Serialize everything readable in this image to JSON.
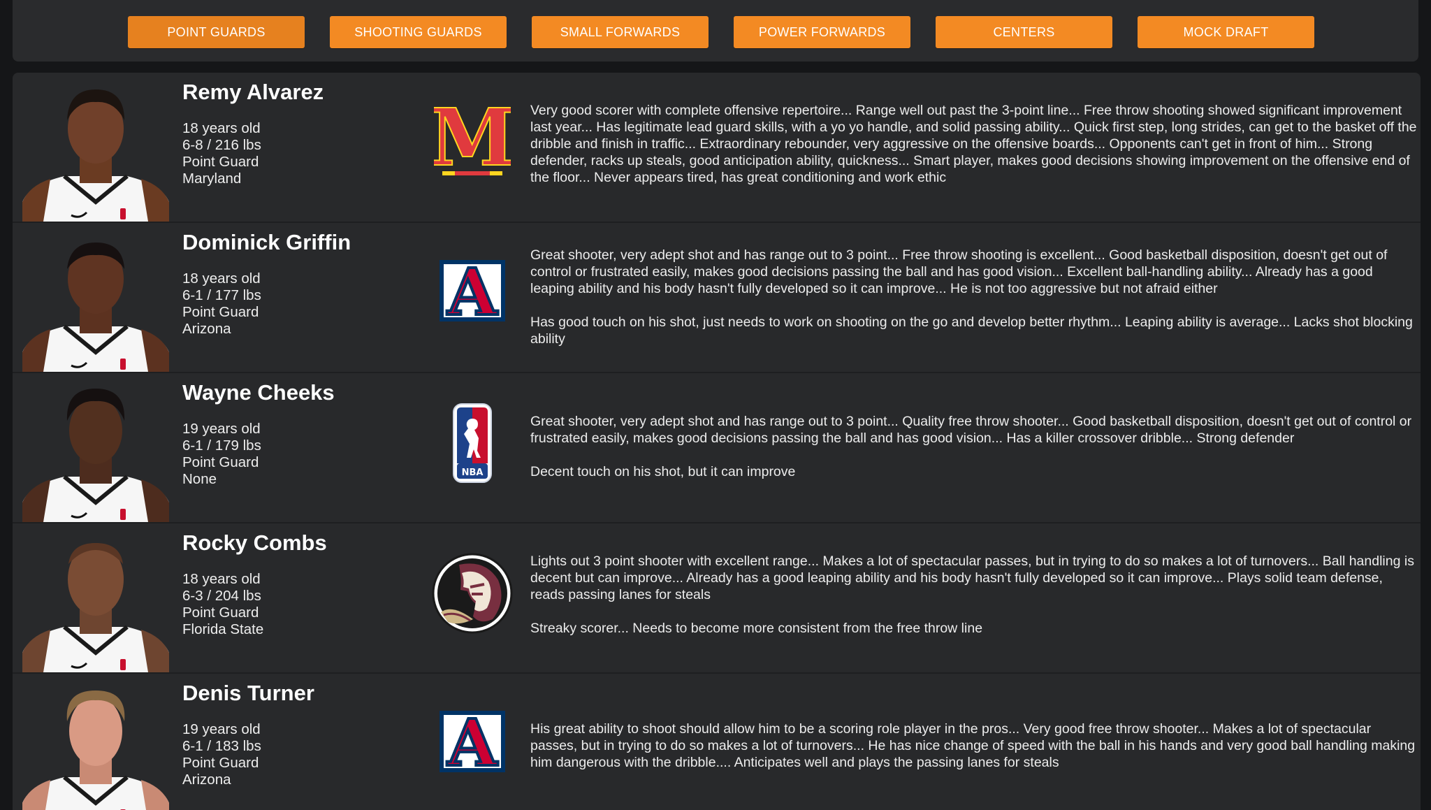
{
  "nav": [
    {
      "label": "POINT GUARDS",
      "active": true
    },
    {
      "label": "SHOOTING GUARDS"
    },
    {
      "label": "SMALL FORWARDS"
    },
    {
      "label": "POWER FORWARDS"
    },
    {
      "label": "CENTERS"
    },
    {
      "label": "MOCK DRAFT"
    }
  ],
  "players": [
    {
      "name": "Remy Alvarez",
      "age": "18 years old",
      "size": "6-8 / 216 lbs",
      "position": "Point Guard",
      "school": "Maryland",
      "logo": "maryland-logo",
      "strengths": "Very good scorer with complete offensive repertoire... Range well out past the 3-point line... Free throw shooting showed significant improvement last year... Has legitimate lead guard skills, with a yo yo handle, and solid passing ability... Quick first step, long strides, can get to the basket off the dribble and finish in traffic... Extraordinary rebounder, very aggressive on the offensive boards... Opponents can't get in front of him... Strong defender, racks up steals, good anticipation ability, quickness... Smart player, makes good decisions showing improvement on the offensive end of the floor... Never appears tired, has great conditioning and work ethic",
      "weaknesses": ""
    },
    {
      "name": "Dominick Griffin",
      "age": "18 years old",
      "size": "6-1 / 177 lbs",
      "position": "Point Guard",
      "school": "Arizona",
      "logo": "arizona-logo",
      "strengths": "Great shooter, very adept shot and has range out to 3 point... Free throw shooting is excellent... Good basketball disposition, doesn't get out of control or frustrated easily, makes good decisions passing the ball and has good vision... Excellent ball-handling ability... Already has a good leaping ability and his body hasn't fully developed so it can improve... He is not too aggressive but not afraid either",
      "weaknesses": "Has good touch on his shot, just needs to work on shooting on the go and develop better rhythm... Leaping ability is average... Lacks shot blocking ability"
    },
    {
      "name": "Wayne Cheeks",
      "age": "19 years old",
      "size": "6-1 / 179 lbs",
      "position": "Point Guard",
      "school": "None",
      "logo": "nba-logo",
      "strengths": "Great shooter, very adept shot and has range out to 3 point... Quality free throw shooter... Good basketball disposition, doesn't get out of control or frustrated easily, makes good decisions passing the ball and has good vision... Has a killer crossover dribble... Strong defender",
      "weaknesses": "Decent touch on his shot, but it can improve"
    },
    {
      "name": "Rocky Combs",
      "age": "18 years old",
      "size": "6-3 / 204 lbs",
      "position": "Point Guard",
      "school": "Florida State",
      "logo": "florida-state-logo",
      "strengths": "Lights out 3 point shooter with excellent range... Makes a lot of spectacular passes, but in trying to do so makes a lot of turnovers... Ball handling is decent but can improve... Already has a good leaping ability and his body hasn't fully developed so it can improve... Plays solid team defense, reads passing lanes for steals",
      "weaknesses": "Streaky scorer... Needs to become more consistent from the free throw line"
    },
    {
      "name": "Denis Turner",
      "age": "19 years old",
      "size": "6-1 / 183 lbs",
      "position": "Point Guard",
      "school": "Arizona",
      "logo": "arizona-logo",
      "strengths": "His great ability to shoot should allow him to be a scoring role player in the pros... Very good free throw shooter... Makes a lot of spectacular passes, but in trying to do so makes a lot of turnovers... He has nice change of speed with the ball in his hands and very good ball handling making him dangerous with the dribble.... Anticipates well and plays the passing lanes for steals",
      "weaknesses": ""
    }
  ],
  "logos": {
    "maryland_letter": "M",
    "arizona_letter": "A",
    "nba_text": "NBA"
  },
  "colors": {
    "accent": "#f38a23",
    "panel": "#28292b",
    "maryland_red": "#e03a3e",
    "maryland_gold": "#ffd520",
    "arizona_red": "#cc0033",
    "arizona_navy": "#003366",
    "nba_blue": "#1d428a",
    "nba_red": "#c8102e",
    "fsu_garnet": "#782f40"
  }
}
